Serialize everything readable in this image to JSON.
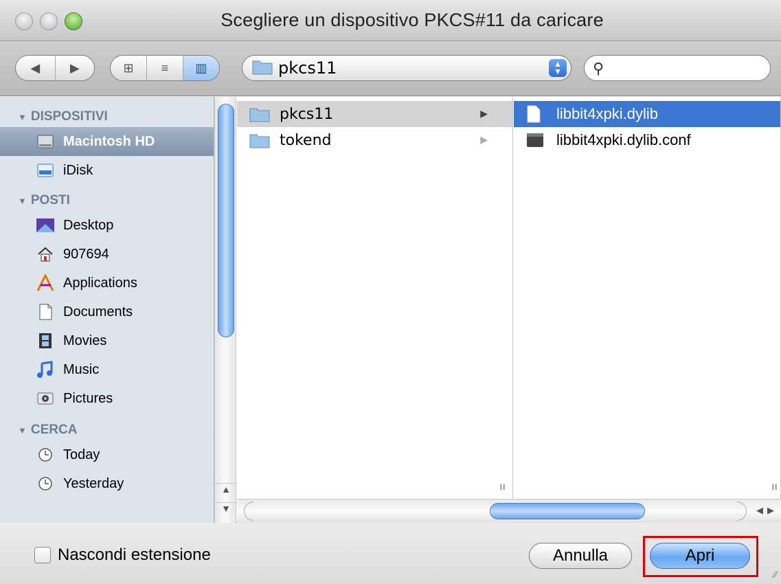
{
  "window": {
    "title": "Scegliere un dispositivo PKCS#11 da caricare"
  },
  "toolbar": {
    "back_icon": "◀",
    "forward_icon": "▶",
    "view_icon_icon": "⊞",
    "view_list_icon": "≡",
    "view_column_icon": "▥",
    "location": "pkcs11",
    "search_placeholder": ""
  },
  "sidebar": {
    "sections": [
      {
        "label": "DISPOSITIVI",
        "items": [
          {
            "label": "Macintosh HD",
            "icon": "harddisk-icon",
            "selected": true
          },
          {
            "label": "iDisk",
            "icon": "idisk-icon",
            "selected": false
          }
        ]
      },
      {
        "label": "POSTI",
        "items": [
          {
            "label": "Desktop",
            "icon": "desktop-icon"
          },
          {
            "label": "907694",
            "icon": "home-icon"
          },
          {
            "label": "Applications",
            "icon": "applications-icon"
          },
          {
            "label": "Documents",
            "icon": "documents-icon"
          },
          {
            "label": "Movies",
            "icon": "movies-icon"
          },
          {
            "label": "Music",
            "icon": "music-icon"
          },
          {
            "label": "Pictures",
            "icon": "pictures-icon"
          }
        ]
      },
      {
        "label": "CERCA",
        "items": [
          {
            "label": "Today",
            "icon": "clock-icon"
          },
          {
            "label": "Yesterday",
            "icon": "clock-icon"
          }
        ]
      }
    ]
  },
  "columns": {
    "col1": [
      {
        "label": "pkcs11",
        "selected": true
      },
      {
        "label": "tokend",
        "selected": false
      }
    ],
    "col2": [
      {
        "label": "libbit4xpki.dylib",
        "selected": true
      },
      {
        "label": "libbit4xpki.dylib.conf",
        "selected": false
      }
    ]
  },
  "bottom": {
    "hide_extension_label": "Nascondi estensione",
    "cancel_label": "Annulla",
    "open_label": "Apri"
  },
  "colors": {
    "selection_blue": "#3b76d1",
    "sidebar_bg": "#dde4ec",
    "highlight_red": "#e00000"
  }
}
